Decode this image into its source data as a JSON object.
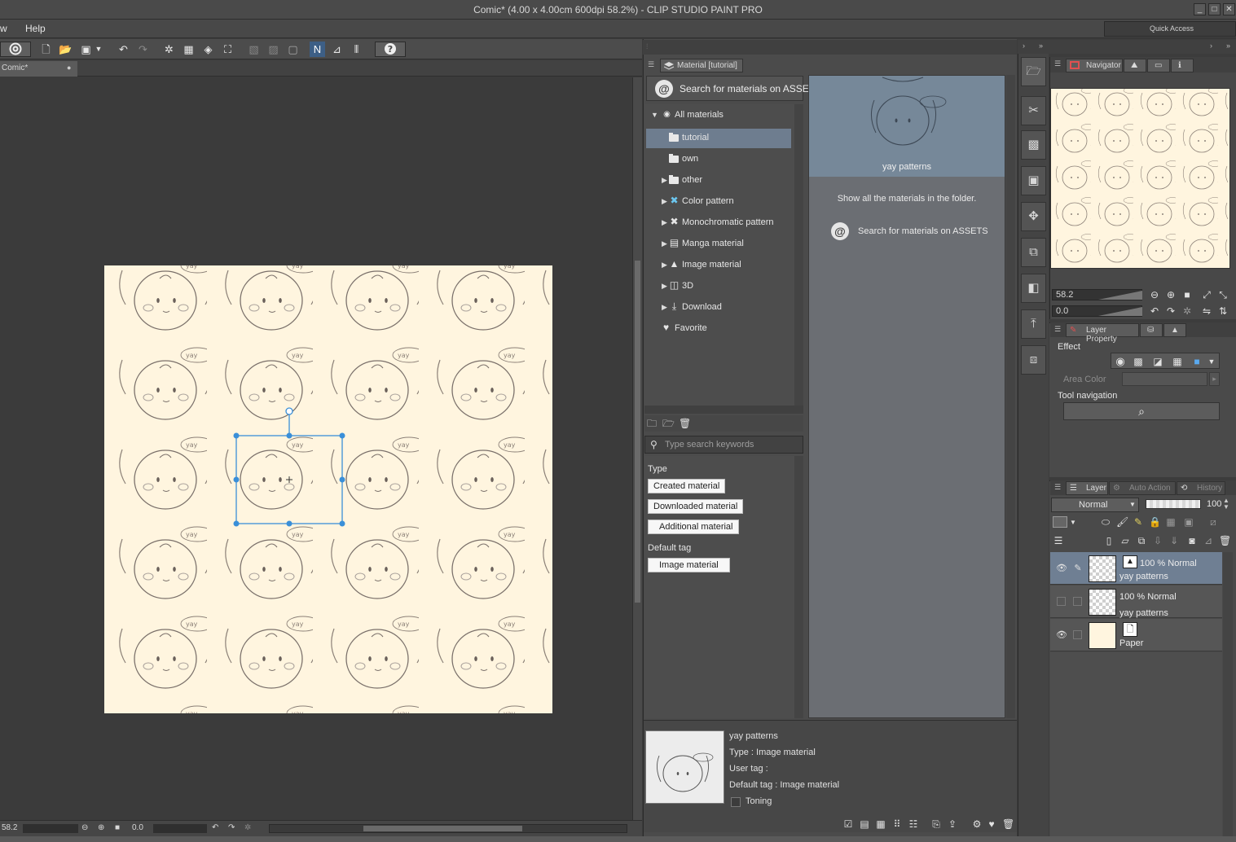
{
  "window": {
    "title": "Comic* (4.00 x 4.00cm 600dpi 58.2%)  - CLIP STUDIO PAINT PRO"
  },
  "menu": {
    "items": [
      "w",
      "Help"
    ],
    "quick_access": "Quick Access"
  },
  "document": {
    "tab_label": "Comic*",
    "status_zoom": "58.2",
    "status_angle": "0.0"
  },
  "material_panel": {
    "tab_label": "Material [tutorial]",
    "assets_search": "Search for materials on ASSETS",
    "tree": [
      {
        "label": "All materials",
        "expanded": true
      },
      {
        "label": "tutorial",
        "selected": true
      },
      {
        "label": "own"
      },
      {
        "label": "other"
      },
      {
        "label": "Color pattern"
      },
      {
        "label": "Monochromatic pattern"
      },
      {
        "label": "Manga material"
      },
      {
        "label": "Image material"
      },
      {
        "label": "3D"
      },
      {
        "label": "Download"
      },
      {
        "label": "Favorite"
      }
    ],
    "search_placeholder": "Type search keywords",
    "type_label": "Type",
    "type_chips": [
      "Created material",
      "Downloaded material",
      "Additional material"
    ],
    "default_tag_label": "Default tag",
    "default_tag_chips": [
      "Image material"
    ],
    "preview_item_label": "yay patterns",
    "show_all_text": "Show all the materials in the folder.",
    "assets_search_2": "Search for materials on ASSETS",
    "info": {
      "name": "yay patterns",
      "type": "Type : Image material",
      "user_tag": "User tag :",
      "default_tag": "Default tag : Image material",
      "toning": "Toning"
    }
  },
  "navigator": {
    "tab_label": "Navigator",
    "zoom": "58.2",
    "angle": "0.0"
  },
  "layer_property": {
    "tab_label": "Layer Property",
    "effect_label": "Effect",
    "area_color_label": "Area Color",
    "tool_navigation_label": "Tool navigation"
  },
  "layer_panel": {
    "tabs": [
      "Layer",
      "Auto Action",
      "History"
    ],
    "blend_mode": "Normal",
    "opacity": "100",
    "layers": [
      {
        "top": "100 % Normal",
        "name": "yay patterns",
        "selected": true,
        "visible": true
      },
      {
        "top": "100 % Normal",
        "name": "yay patterns",
        "selected": false,
        "visible": false
      },
      {
        "top": "",
        "name": "Paper",
        "selected": false,
        "visible": true
      }
    ]
  },
  "colors": {
    "paper": "#fff5df",
    "selection": "#6e7d8f",
    "transform_box": "#3a8fd8"
  }
}
